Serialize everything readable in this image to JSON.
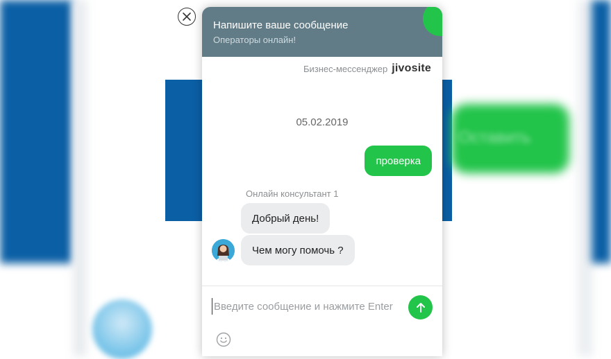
{
  "colors": {
    "header": "#617c87",
    "accent_green": "#22c44a",
    "page_blue": "#0b5fa5",
    "bubble_in": "#ebecee"
  },
  "background": {
    "blurred_button_label": "Оставить"
  },
  "close_icon": "close-icon",
  "chat": {
    "header": {
      "title": "Напишите ваше сообщение",
      "subtitle": "Операторы онлайн!"
    },
    "brand": {
      "text": "Бизнес-мессенджер",
      "logo": "jivosite"
    },
    "date": "05.02.2019",
    "messages": [
      {
        "from": "visitor",
        "text": "проверка"
      },
      {
        "from": "agent",
        "author": "Онлайн консультант 1",
        "text": "Добрый день!"
      },
      {
        "from": "agent",
        "text": "Чем могу помочь ?"
      }
    ],
    "input": {
      "placeholder": "Введите сообщение и нажмите Enter",
      "value": ""
    },
    "icons": {
      "send": "send-arrow-icon",
      "emoji": "smiley-icon",
      "agent_avatar": "agent-avatar-icon"
    }
  }
}
